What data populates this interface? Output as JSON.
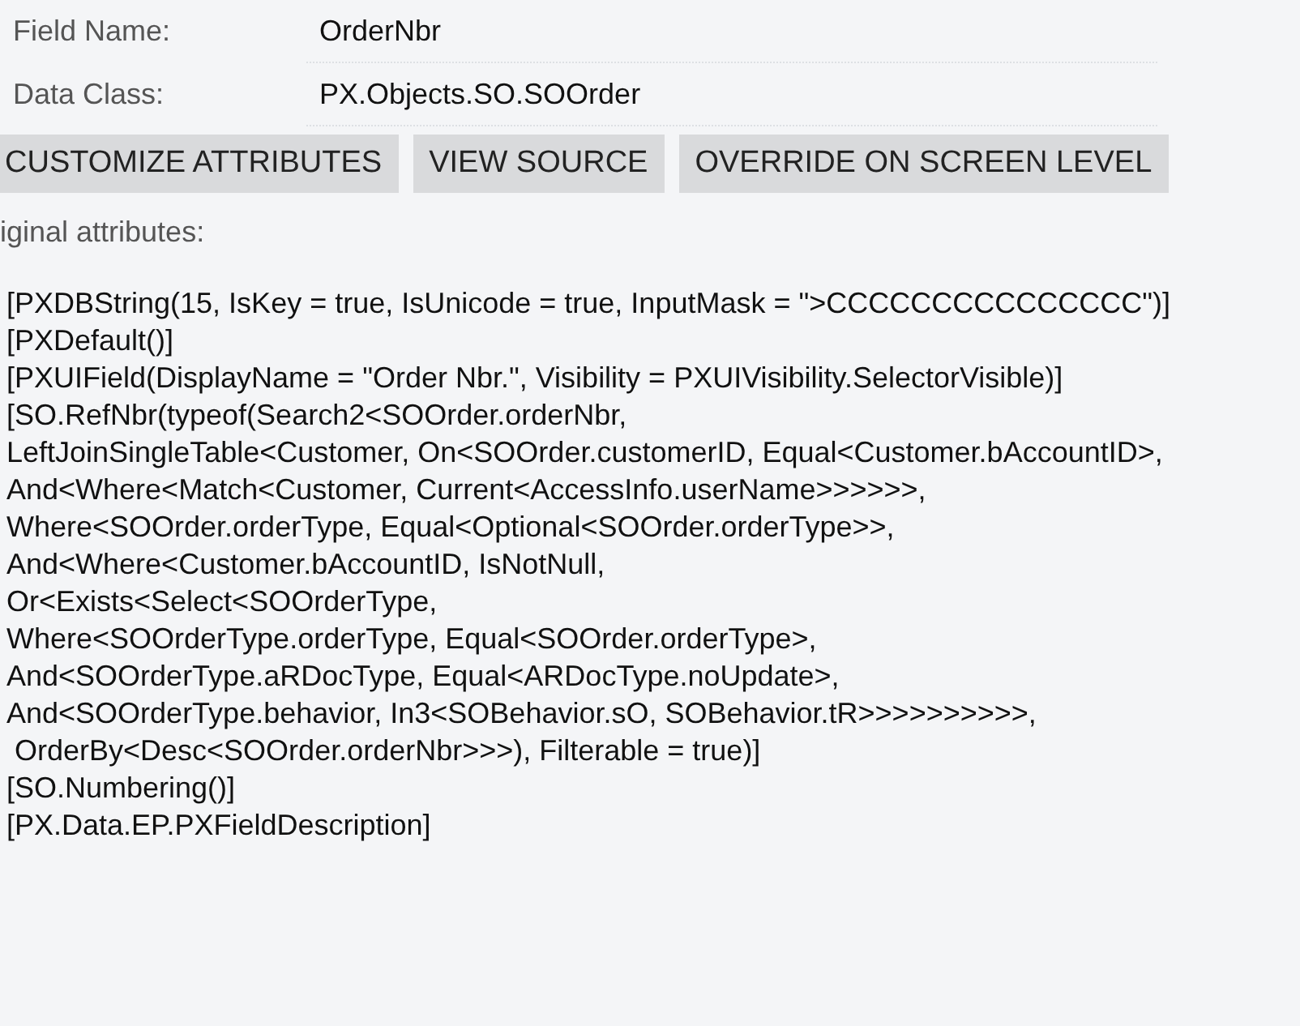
{
  "fields": [
    {
      "label": "Field Name:",
      "value": "OrderNbr"
    },
    {
      "label": "Data Class:",
      "value": "PX.Objects.SO.SOOrder"
    }
  ],
  "buttons": [
    "CUSTOMIZE ATTRIBUTES",
    "VIEW SOURCE",
    "OVERRIDE ON SCREEN LEVEL"
  ],
  "attributes_heading": "iginal attributes:",
  "attributes": [
    "[PXDBString(15, IsKey = true, IsUnicode = true, InputMask = \">CCCCCCCCCCCCCCC\")]",
    "[PXDefault()]",
    "[PXUIField(DisplayName = \"Order Nbr.\", Visibility = PXUIVisibility.SelectorVisible)]",
    "[SO.RefNbr(typeof(Search2<SOOrder.orderNbr,",
    "LeftJoinSingleTable<Customer, On<SOOrder.customerID, Equal<Customer.bAccountID>,",
    "And<Where<Match<Customer, Current<AccessInfo.userName>>>>>>,",
    "Where<SOOrder.orderType, Equal<Optional<SOOrder.orderType>>,",
    "And<Where<Customer.bAccountID, IsNotNull,",
    "Or<Exists<Select<SOOrderType,",
    "Where<SOOrderType.orderType, Equal<SOOrder.orderType>,",
    "And<SOOrderType.aRDocType, Equal<ARDocType.noUpdate>,",
    "And<SOOrderType.behavior, In3<SOBehavior.sO, SOBehavior.tR>>>>>>>>>>,",
    " OrderBy<Desc<SOOrder.orderNbr>>>), Filterable = true)]",
    "[SO.Numbering()]",
    "[PX.Data.EP.PXFieldDescription]"
  ]
}
